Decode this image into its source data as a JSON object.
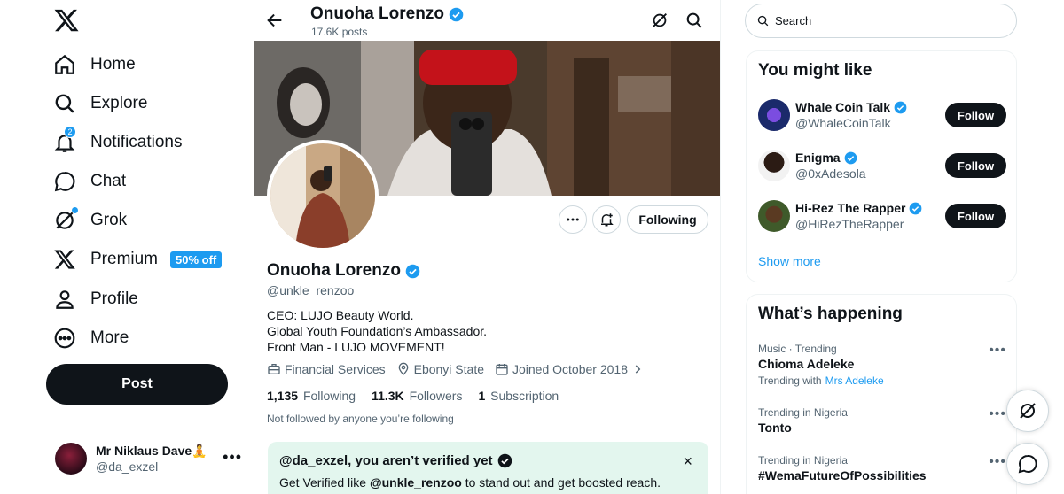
{
  "nav": {
    "items": [
      {
        "label": "Home",
        "icon": "home-icon"
      },
      {
        "label": "Explore",
        "icon": "search-icon"
      },
      {
        "label": "Notifications",
        "icon": "bell-icon",
        "badge": "2"
      },
      {
        "label": "Chat",
        "icon": "chat-icon"
      },
      {
        "label": "Grok",
        "icon": "grok-icon"
      },
      {
        "label": "Premium",
        "icon": "x-icon",
        "promo": "50% off"
      },
      {
        "label": "Profile",
        "icon": "person-icon"
      },
      {
        "label": "More",
        "icon": "more-circle-icon"
      }
    ],
    "post_label": "Post"
  },
  "account": {
    "name": "Mr Niklaus Dave",
    "handle": "@da_exzel",
    "emoji": "🧘"
  },
  "header": {
    "name": "Onuoha Lorenzo",
    "posts": "17.6K posts"
  },
  "profile": {
    "name": "Onuoha Lorenzo",
    "handle": "@unkle_renzoo",
    "bio": [
      "CEO: LUJO Beauty World.",
      "Global Youth Foundation’s Ambassador.",
      "Front Man - LUJO MOVEMENT!"
    ],
    "category": "Financial Services",
    "location": "Ebonyi State",
    "joined": "Joined October 2018",
    "following_count": "1,135",
    "following_label": "Following",
    "followers_count": "11.3K",
    "followers_label": "Followers",
    "subscription_count": "1",
    "subscription_label": "Subscription",
    "not_followed": "Not followed by anyone you’re following",
    "following_button": "Following"
  },
  "verify_card": {
    "title": "@da_exzel, you aren’t verified yet",
    "body_prefix": "Get Verified like ",
    "body_handle": "@unkle_renzoo",
    "body_suffix": " to stand out and get boosted reach.",
    "close": "×"
  },
  "search": {
    "placeholder": "Search"
  },
  "you_might_like": {
    "title": "You might like",
    "users": [
      {
        "name": "Whale Coin Talk",
        "handle": "@WhaleCoinTalk",
        "button": "Follow"
      },
      {
        "name": "Enigma",
        "handle": "@0xAdesola",
        "button": "Follow"
      },
      {
        "name": "Hi-Rez The Rapper",
        "handle": "@HiRezTheRapper",
        "button": "Follow"
      }
    ],
    "show_more": "Show more"
  },
  "whats_happening": {
    "title": "What’s happening",
    "trends": [
      {
        "meta": "Music · Trending",
        "name": "Chioma Adeleke",
        "with_label": "Trending with",
        "with_link": "Mrs Adeleke"
      },
      {
        "meta": "Trending in Nigeria",
        "name": "Tonto"
      },
      {
        "meta": "Trending in Nigeria",
        "name": "#WemaFutureOfPossibilities"
      }
    ]
  },
  "colors": {
    "accent": "#1d9bf0",
    "text": "#0f1419",
    "muted": "#536471",
    "verify_bg": "#e3f6ee"
  }
}
